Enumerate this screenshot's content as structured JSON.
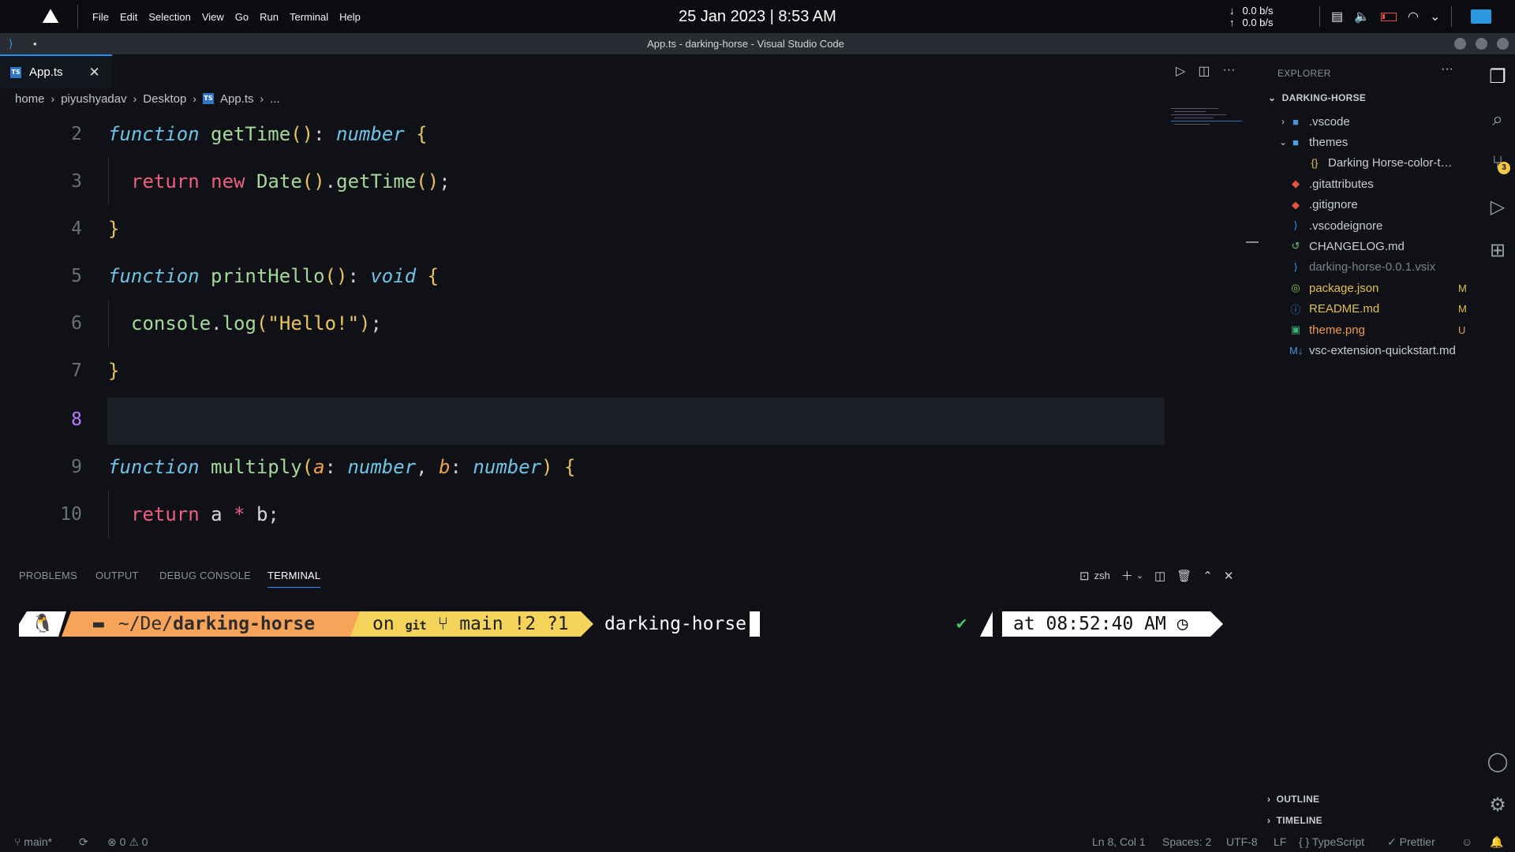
{
  "system": {
    "menu": [
      "File",
      "Edit",
      "Selection",
      "View",
      "Go",
      "Run",
      "Terminal",
      "Help"
    ],
    "clock": "25 Jan 2023 | 8:53 AM",
    "net_down": "0.0 b/s",
    "net_up": "0.0 b/s"
  },
  "window": {
    "dirty_indicator": "•",
    "title": "App.ts - darking-horse - Visual Studio Code"
  },
  "tab": {
    "label": "App.ts",
    "icon_text": "TS",
    "close": "✕"
  },
  "breadcrumb": [
    "home",
    "piyushyadav",
    "Desktop",
    "App.ts",
    "..."
  ],
  "editor": {
    "line_numbers": [
      "2",
      "3",
      "4",
      "5",
      "6",
      "7",
      "8",
      "9",
      "10"
    ],
    "current_line": "8"
  },
  "panel": {
    "tabs": [
      "PROBLEMS",
      "OUTPUT",
      "DEBUG CONSOLE",
      "TERMINAL"
    ],
    "active_tab": "TERMINAL",
    "shell": "zsh"
  },
  "terminal": {
    "dir_prefix": "~/De/",
    "dir_bold": "darking-horse",
    "git_on": "on",
    "git_label": "git",
    "branch": "main !2 ?1",
    "command": "darking-horse",
    "time": "at 08:52:40 AM"
  },
  "explorer": {
    "header": "EXPLORER",
    "root": "DARKING-HORSE",
    "items": [
      {
        "name": ".vscode",
        "badge": "",
        "color": "#c9ccd3"
      },
      {
        "name": "themes",
        "badge": "",
        "color": "#c9ccd3"
      },
      {
        "name": "Darking Horse-color-theme.json",
        "badge": "",
        "color": "#c9ccd3"
      },
      {
        "name": ".gitattributes",
        "badge": "",
        "color": "#c9ccd3"
      },
      {
        "name": ".gitignore",
        "badge": "",
        "color": "#c9ccd3"
      },
      {
        "name": ".vscodeignore",
        "badge": "",
        "color": "#c9ccd3"
      },
      {
        "name": "CHANGELOG.md",
        "badge": "",
        "color": "#c9ccd3"
      },
      {
        "name": "darking-horse-0.0.1.vsix",
        "badge": "",
        "color": "#7b808a"
      },
      {
        "name": "package.json",
        "badge": "M",
        "color": "#e2c04f"
      },
      {
        "name": "README.md",
        "badge": "M",
        "color": "#e2c04f"
      },
      {
        "name": "theme.png",
        "badge": "U",
        "color": "#f09a4b"
      },
      {
        "name": "vsc-extension-quickstart.md",
        "badge": "",
        "color": "#c9ccd3"
      }
    ],
    "outline": "OUTLINE",
    "timeline": "TIMELINE"
  },
  "activity": {
    "scm_count": "3"
  },
  "status": {
    "branch": "main*",
    "errors": "0",
    "warnings": "0",
    "position": "Ln 8, Col 1",
    "spaces": "Spaces: 2",
    "encoding": "UTF-8",
    "eol": "LF",
    "language": "TypeScript",
    "formatter": "Prettier"
  },
  "colors": {
    "accent": "#1f90ff",
    "keyword_fn": "#6fc4e6",
    "function_name": "#a4d89a",
    "keyword": "#ec5f7e",
    "string": "#e8c55c",
    "param": "#f0a04b"
  }
}
